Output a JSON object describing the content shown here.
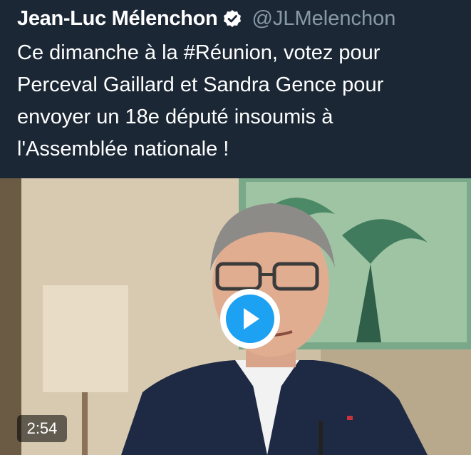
{
  "author": {
    "display_name": "Jean-Luc Mélenchon",
    "handle": "@JLMelenchon",
    "verified_icon": "verified-badge-icon"
  },
  "tweet": {
    "text": "Ce dimanche à la #Réunion, votez pour\nPerceval Gaillard et Sandra Gence pour\nenvoyer un 18e député insoumis à\nl'Assemblée nationale !"
  },
  "video": {
    "duration": "2:54",
    "play_icon": "play-icon"
  },
  "colors": {
    "background": "#1b2735",
    "handle": "#8899a6",
    "accent": "#1da1f2"
  }
}
